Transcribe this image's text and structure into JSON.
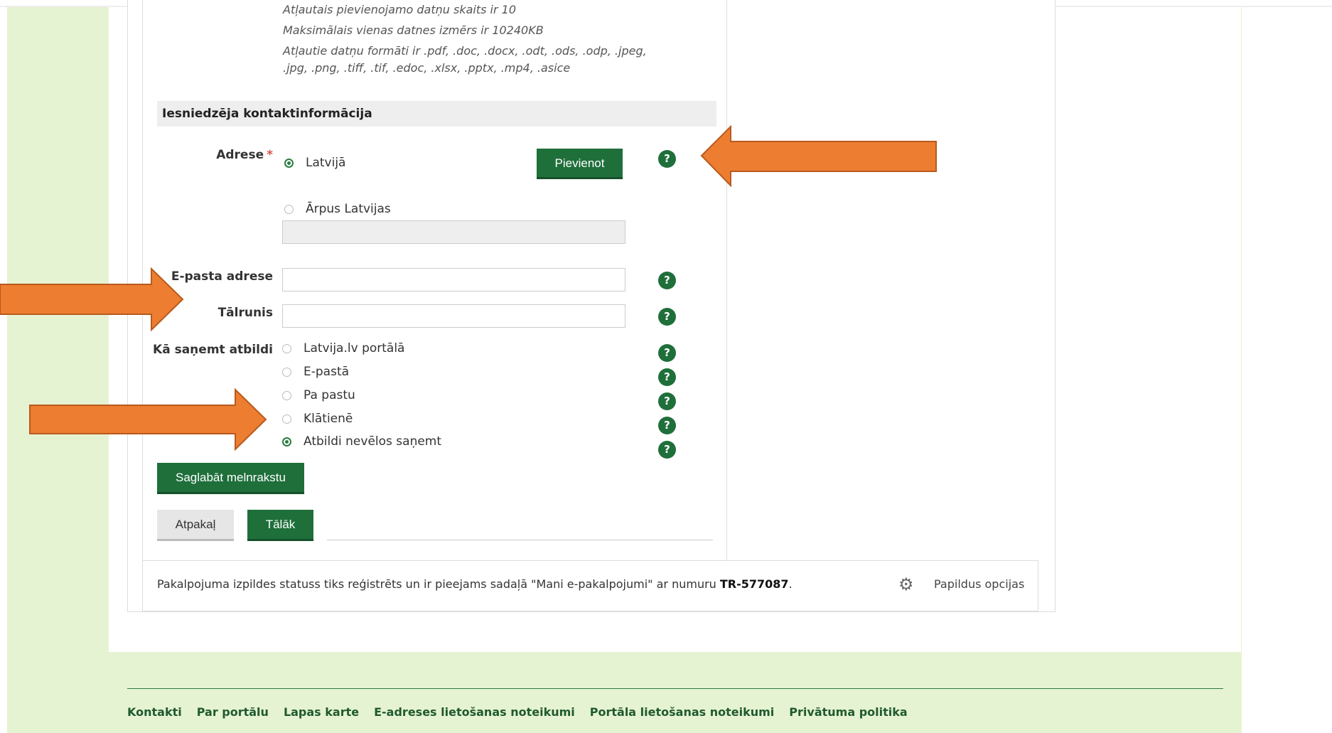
{
  "info": {
    "line1": "Atļautais pievienojamo datņu skaits ir 10",
    "line2": "Maksimālais vienas datnes izmērs ir 10240KB",
    "line3": "Atļautie datņu formāti ir .pdf, .doc, .docx, .odt, .ods, .odp, .jpeg,",
    "line4": ".jpg, .png, .tiff, .tif, .edoc, .xlsx, .pptx, .mp4, .asice"
  },
  "section": {
    "title": "Iesniedzēja kontaktinformācija"
  },
  "address": {
    "label": "Adrese",
    "required_mark": "*",
    "option_latvia": "Latvijā",
    "option_abroad": "Ārpus Latvijas",
    "add_button": "Pievienot",
    "abroad_value": ""
  },
  "email": {
    "label": "E-pasta adrese",
    "value": ""
  },
  "phone": {
    "label": "Tālrunis",
    "value": ""
  },
  "reply": {
    "label": "Kā saņemt atbildi",
    "options": [
      {
        "label": "Latvija.lv portālā",
        "selected": false
      },
      {
        "label": "E-pastā",
        "selected": false
      },
      {
        "label": "Pa pastu",
        "selected": false
      },
      {
        "label": "Klātienē",
        "selected": false
      },
      {
        "label": "Atbildi nevēlos saņemt",
        "selected": true
      }
    ]
  },
  "help_label": "?",
  "buttons": {
    "save_draft": "Saglabāt melnrakstu",
    "back": "Atpakaļ",
    "next": "Tālāk"
  },
  "status": {
    "text_before": "Pakalpojuma izpildes statuss tiks reģistrēts un ir pieejams sadaļā \"Mani e-pakalpojumi\" ar numuru ",
    "number": "TR-577087",
    "text_after": ".",
    "options_label": "Papildus opcijas",
    "options_icon": "gear-icon"
  },
  "footer": {
    "links": [
      "Kontakti",
      "Par portālu",
      "Lapas karte",
      "E-adreses lietošanas noteikumi",
      "Portāla lietošanas noteikumi",
      "Privātuma politika"
    ]
  },
  "colors": {
    "accent_green": "#1f6f3b",
    "page_bg": "#e6f3d2",
    "arrow_orange": "#ed7d31",
    "required_red": "#d9534f"
  }
}
